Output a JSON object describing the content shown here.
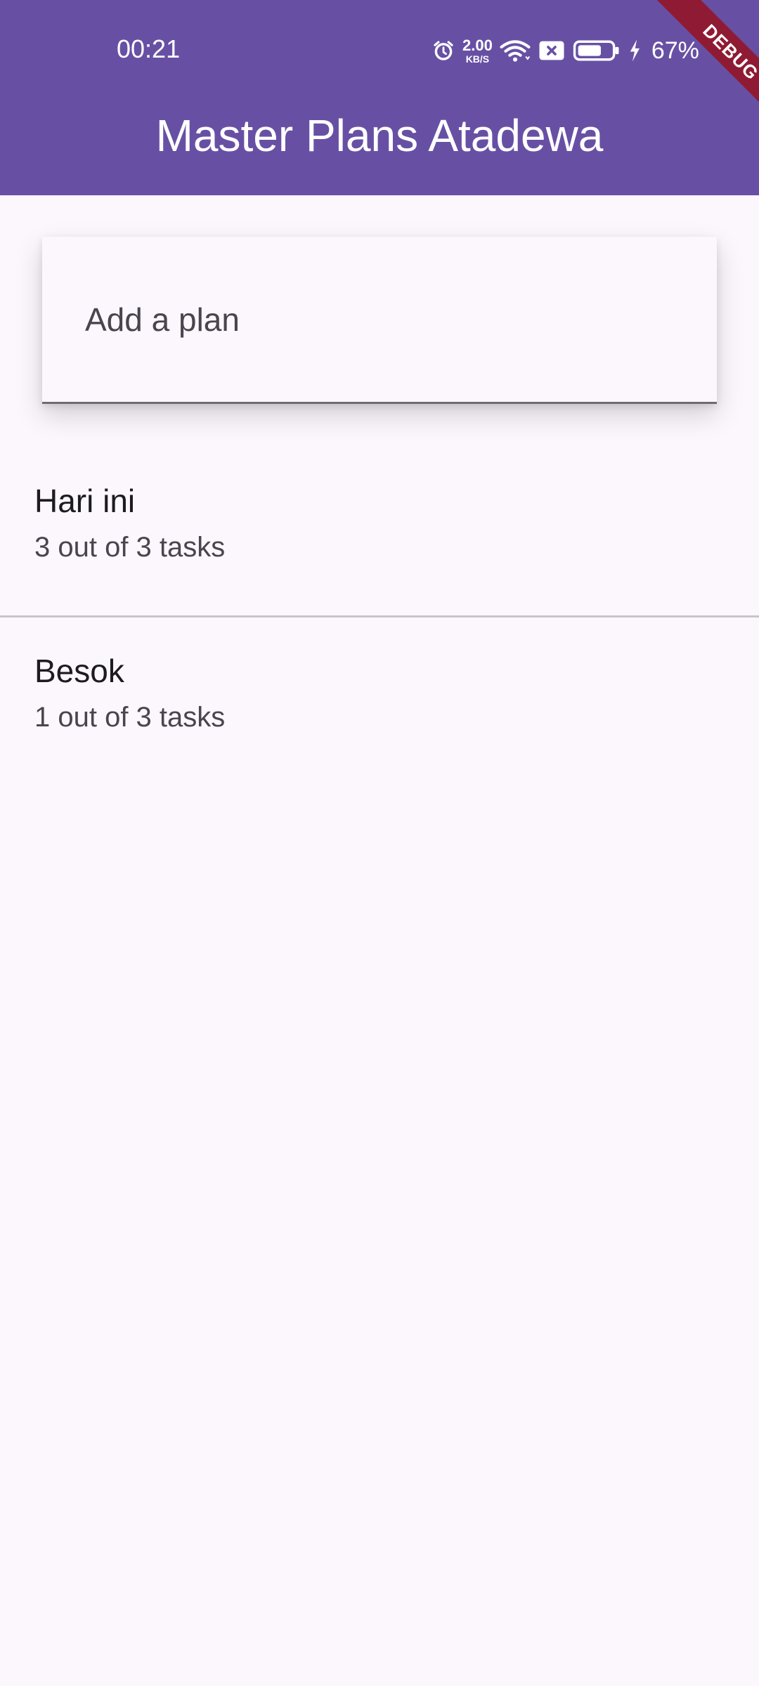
{
  "status_bar": {
    "time": "00:21",
    "net_speed_value": "2.00",
    "net_speed_unit": "KB/S",
    "battery_percent": "67%",
    "icons": [
      "alarm-icon",
      "wifi-icon",
      "sim-blocked-icon",
      "battery-icon",
      "charging-icon"
    ]
  },
  "app_bar": {
    "title": "Master Plans Atadewa",
    "background_color": "#6750A4"
  },
  "debug_banner": {
    "label": "DEBUG",
    "color": "#8E1B33"
  },
  "add_plan": {
    "placeholder": "Add a plan",
    "value": ""
  },
  "plans": [
    {
      "title": "Hari ini",
      "progress": "3 out of 3 tasks"
    },
    {
      "title": "Besok",
      "progress": "1 out of 3 tasks"
    }
  ],
  "colors": {
    "background": "#FCF7FC",
    "divider": "#C9C5CC"
  }
}
